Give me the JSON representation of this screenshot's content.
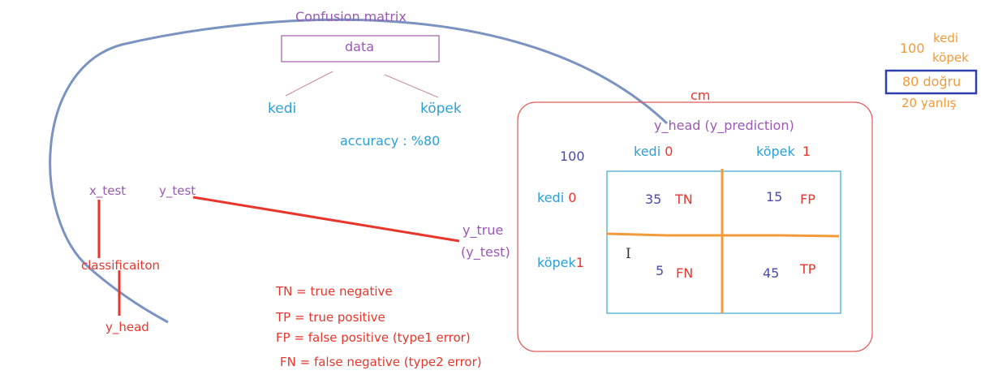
{
  "title": "Confusion matrix",
  "data_box": "data",
  "tree": {
    "left": "kedi",
    "right": "köpek"
  },
  "accuracy": "accuracy : %80",
  "cm_label": "cm",
  "y_head_pred": "y_head (y_prediction)",
  "total": "100",
  "col_headers": [
    {
      "label": "kedi",
      "value": "0"
    },
    {
      "label": "köpek",
      "value": "1"
    }
  ],
  "row_headers": [
    {
      "label": "kedi",
      "value": "0"
    },
    {
      "label": "köpek",
      "value": "1"
    }
  ],
  "cells": [
    {
      "value": "35",
      "code": "TN"
    },
    {
      "value": "15",
      "code": "FP"
    },
    {
      "value": "5",
      "code": "FN"
    },
    {
      "value": "45",
      "code": "TP"
    }
  ],
  "y_true": "y_true",
  "y_test_paren": "(y_test)",
  "x_test": "x_test",
  "y_test": "y_test",
  "classification": "classificaiton",
  "y_head": "y_head",
  "legend": [
    "TN = true negative",
    "TP = true positive",
    "FP = false positive (type1 error)",
    "FN = false negative (type2 error)"
  ],
  "side_note": {
    "count": "100",
    "kedi": "kedi",
    "kopek": "köpek",
    "correct": "80 doğru",
    "wrong": "20 yanlış"
  },
  "cursor_glyph": "I",
  "colors": {
    "purple": "#9b59b6",
    "blue": "#2e9fd6",
    "red": "#e8362c",
    "navy": "#4a4aa8",
    "orange": "#f39a3a",
    "curve": "#7b93c0"
  }
}
